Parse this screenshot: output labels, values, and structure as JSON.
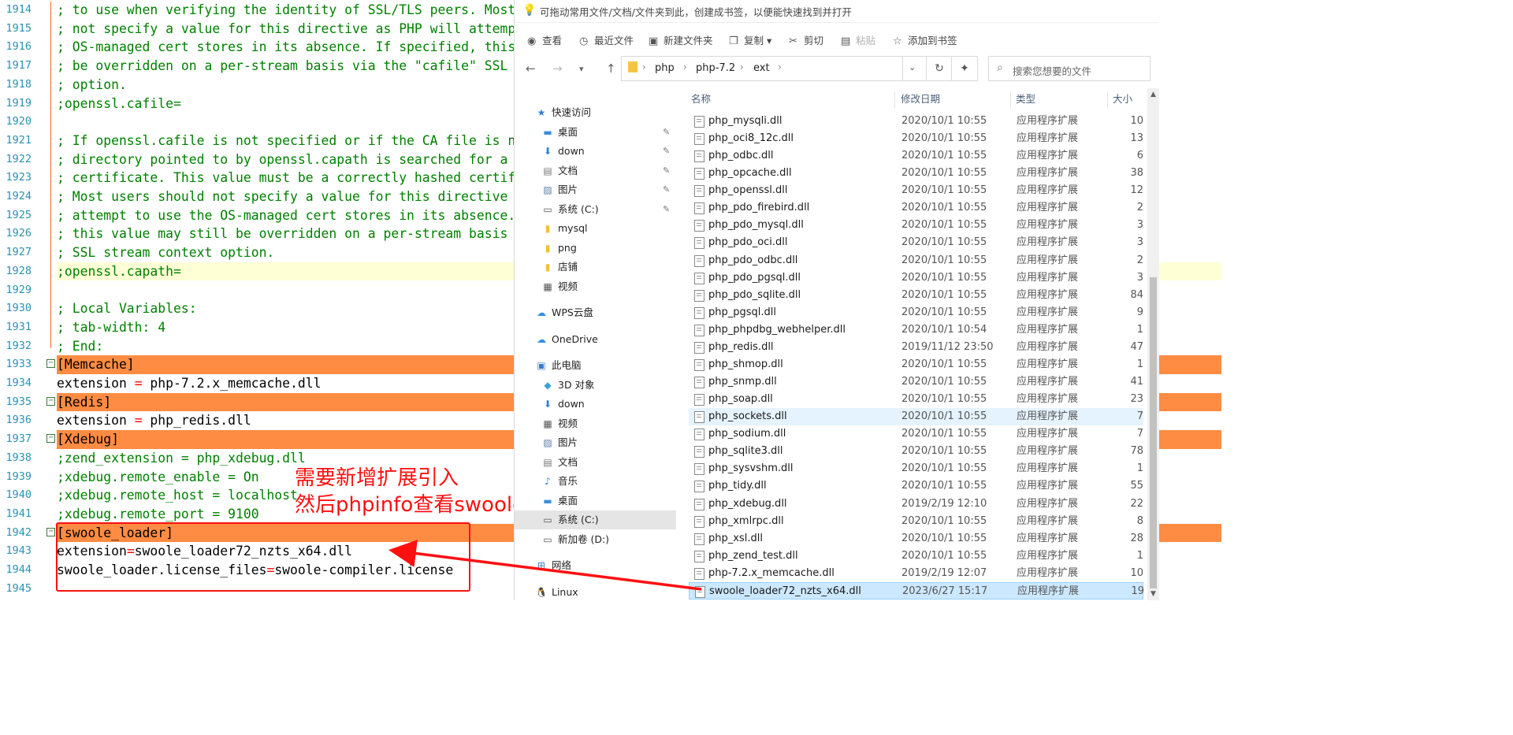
{
  "editor": {
    "lines": [
      {
        "n": "1914",
        "t": "; to use when verifying the identity of SSL/TLS peers. Most users should",
        "k": "comment"
      },
      {
        "n": "1915",
        "t": "; not specify a value for this directive as PHP will attempt to use the",
        "k": "comment"
      },
      {
        "n": "1916",
        "t": "; OS-managed cert stores in its absence. If specified, this value may still",
        "k": "comment"
      },
      {
        "n": "1917",
        "t": "; be overridden on a per-stream basis via the \"cafile\" SSL stream context",
        "k": "comment"
      },
      {
        "n": "1918",
        "t": "; option.",
        "k": "comment"
      },
      {
        "n": "1919",
        "t": ";openssl.cafile=",
        "k": "comment"
      },
      {
        "n": "1920",
        "t": "",
        "k": "comment"
      },
      {
        "n": "1921",
        "t": "; If openssl.cafile is not specified or if the CA file is not found, the",
        "k": "comment"
      },
      {
        "n": "1922",
        "t": "; directory pointed to by openssl.capath is searched for a suitable",
        "k": "comment"
      },
      {
        "n": "1923",
        "t": "; certificate. This value must be a correctly hashed certificate directory.",
        "k": "comment"
      },
      {
        "n": "1924",
        "t": "; Most users should not specify a value for this directive as PHP will",
        "k": "comment"
      },
      {
        "n": "1925",
        "t": "; attempt to use the OS-managed cert stores in its absence. If specified,",
        "k": "comment"
      },
      {
        "n": "1926",
        "t": "; this value may still be overridden on a per-stream basis via the \"capath\"",
        "k": "comment"
      },
      {
        "n": "1927",
        "t": "; SSL stream context option.",
        "k": "comment"
      },
      {
        "n": "1928",
        "t": ";openssl.capath=",
        "k": "comment",
        "hl": true
      },
      {
        "n": "1929",
        "t": "",
        "k": "comment"
      },
      {
        "n": "1930",
        "t": "; Local Variables:",
        "k": "comment"
      },
      {
        "n": "1931",
        "t": "; tab-width: 4",
        "k": "comment"
      },
      {
        "n": "1932",
        "t": "; End:",
        "k": "comment"
      },
      {
        "n": "1933",
        "t": "[Memcache]",
        "k": "section"
      },
      {
        "n": "1934",
        "a": "extension ",
        "o": "=",
        "b": " php-7.2.x_memcache.dll",
        "k": "kv"
      },
      {
        "n": "1935",
        "t": "[Redis]",
        "k": "section"
      },
      {
        "n": "1936",
        "a": "extension ",
        "o": "=",
        "b": " php_redis.dll",
        "k": "kv"
      },
      {
        "n": "1937",
        "t": "[Xdebug]",
        "k": "section"
      },
      {
        "n": "1938",
        "t": ";zend_extension = php_xdebug.dll",
        "k": "comment"
      },
      {
        "n": "1939",
        "t": ";xdebug.remote_enable = On",
        "k": "comment"
      },
      {
        "n": "1940",
        "t": ";xdebug.remote_host = localhost",
        "k": "comment"
      },
      {
        "n": "1941",
        "t": ";xdebug.remote_port = 9100",
        "k": "comment"
      },
      {
        "n": "1942",
        "t": "[swoole_loader]",
        "k": "section"
      },
      {
        "n": "1943",
        "a": "extension",
        "o": "=",
        "b": "swoole_loader72_nzts_x64.dll",
        "k": "kv"
      },
      {
        "n": "1944",
        "a": "swoole_loader.license_files",
        "o": "=",
        "b": "swoole-compiler.license",
        "k": "kv"
      },
      {
        "n": "1945",
        "t": "",
        "k": "comment"
      }
    ]
  },
  "annotation": {
    "line1": "需要新增扩展引入",
    "line2": "然后phpinfo查看swoole_loader是否开启",
    "color": "#ff1010"
  },
  "explorer": {
    "bookmark_hint": "可拖动常用文件/文档/文件夹到此，创建成书签，以便能快速找到并打开",
    "toolbar": [
      "查看",
      "最近文件",
      "新建文件夹",
      "复制",
      "剪切",
      "粘贴",
      "添加到书签"
    ],
    "breadcrumb": [
      "php",
      "php-7.2",
      "ext"
    ],
    "search_placeholder": "搜索您想要的文件",
    "sidebar": [
      {
        "label": "快速访问",
        "icon": "star-icon",
        "level": 0,
        "pin": false
      },
      {
        "label": "桌面",
        "icon": "desktop-icon",
        "level": 1,
        "pin": true
      },
      {
        "label": "down",
        "icon": "download-icon",
        "level": 1,
        "pin": true
      },
      {
        "label": "文档",
        "icon": "document-icon",
        "level": 1,
        "pin": true
      },
      {
        "label": "图片",
        "icon": "picture-icon",
        "level": 1,
        "pin": true
      },
      {
        "label": "系统 (C:)",
        "icon": "drive-icon",
        "level": 1,
        "pin": true
      },
      {
        "label": "mysql",
        "icon": "folder-icon",
        "level": 1,
        "pin": false
      },
      {
        "label": "png",
        "icon": "folder-icon",
        "level": 1,
        "pin": false
      },
      {
        "label": "店铺",
        "icon": "folder-icon",
        "level": 1,
        "pin": false
      },
      {
        "label": "视频",
        "icon": "video-icon",
        "level": 1,
        "pin": false
      },
      {
        "label": "WPS云盘",
        "icon": "cloud-icon",
        "level": 0,
        "pin": false,
        "gap": true
      },
      {
        "label": "OneDrive",
        "icon": "cloud-icon",
        "level": 0,
        "pin": false,
        "gap": true
      },
      {
        "label": "此电脑",
        "icon": "computer-icon",
        "level": 0,
        "pin": false,
        "gap": true
      },
      {
        "label": "3D 对象",
        "icon": "cube-icon",
        "level": 1,
        "pin": false
      },
      {
        "label": "down",
        "icon": "download-icon",
        "level": 1,
        "pin": false
      },
      {
        "label": "视频",
        "icon": "video-icon",
        "level": 1,
        "pin": false
      },
      {
        "label": "图片",
        "icon": "picture-icon",
        "level": 1,
        "pin": false
      },
      {
        "label": "文档",
        "icon": "document-icon",
        "level": 1,
        "pin": false
      },
      {
        "label": "音乐",
        "icon": "music-icon",
        "level": 1,
        "pin": false
      },
      {
        "label": "桌面",
        "icon": "desktop-icon",
        "level": 1,
        "pin": false
      },
      {
        "label": "系统 (C:)",
        "icon": "drive-icon",
        "level": 1,
        "pin": false,
        "sel": true
      },
      {
        "label": "新加卷 (D:)",
        "icon": "drive-icon",
        "level": 1,
        "pin": false
      },
      {
        "label": "网络",
        "icon": "network-icon",
        "level": 0,
        "pin": false,
        "gap": true
      },
      {
        "label": "Linux",
        "icon": "linux-icon",
        "level": 0,
        "pin": false,
        "gap": true
      }
    ],
    "columns": {
      "name": "名称",
      "date": "修改日期",
      "type": "类型",
      "size": "大小"
    },
    "files": [
      {
        "name": "php_mysqli.dll",
        "date": "2020/10/1 10:55",
        "type": "应用程序扩展",
        "size": "10"
      },
      {
        "name": "php_oci8_12c.dll",
        "date": "2020/10/1 10:55",
        "type": "应用程序扩展",
        "size": "13"
      },
      {
        "name": "php_odbc.dll",
        "date": "2020/10/1 10:55",
        "type": "应用程序扩展",
        "size": "6"
      },
      {
        "name": "php_opcache.dll",
        "date": "2020/10/1 10:55",
        "type": "应用程序扩展",
        "size": "38"
      },
      {
        "name": "php_openssl.dll",
        "date": "2020/10/1 10:55",
        "type": "应用程序扩展",
        "size": "12"
      },
      {
        "name": "php_pdo_firebird.dll",
        "date": "2020/10/1 10:55",
        "type": "应用程序扩展",
        "size": "2"
      },
      {
        "name": "php_pdo_mysql.dll",
        "date": "2020/10/1 10:55",
        "type": "应用程序扩展",
        "size": "3"
      },
      {
        "name": "php_pdo_oci.dll",
        "date": "2020/10/1 10:55",
        "type": "应用程序扩展",
        "size": "3"
      },
      {
        "name": "php_pdo_odbc.dll",
        "date": "2020/10/1 10:55",
        "type": "应用程序扩展",
        "size": "2"
      },
      {
        "name": "php_pdo_pgsql.dll",
        "date": "2020/10/1 10:55",
        "type": "应用程序扩展",
        "size": "3"
      },
      {
        "name": "php_pdo_sqlite.dll",
        "date": "2020/10/1 10:55",
        "type": "应用程序扩展",
        "size": "84"
      },
      {
        "name": "php_pgsql.dll",
        "date": "2020/10/1 10:55",
        "type": "应用程序扩展",
        "size": "9"
      },
      {
        "name": "php_phpdbg_webhelper.dll",
        "date": "2020/10/1 10:54",
        "type": "应用程序扩展",
        "size": "1"
      },
      {
        "name": "php_redis.dll",
        "date": "2019/11/12 23:50",
        "type": "应用程序扩展",
        "size": "47"
      },
      {
        "name": "php_shmop.dll",
        "date": "2020/10/1 10:55",
        "type": "应用程序扩展",
        "size": "1"
      },
      {
        "name": "php_snmp.dll",
        "date": "2020/10/1 10:55",
        "type": "应用程序扩展",
        "size": "41"
      },
      {
        "name": "php_soap.dll",
        "date": "2020/10/1 10:55",
        "type": "应用程序扩展",
        "size": "23"
      },
      {
        "name": "php_sockets.dll",
        "date": "2020/10/1 10:55",
        "type": "应用程序扩展",
        "size": "7",
        "hover": true
      },
      {
        "name": "php_sodium.dll",
        "date": "2020/10/1 10:55",
        "type": "应用程序扩展",
        "size": "7"
      },
      {
        "name": "php_sqlite3.dll",
        "date": "2020/10/1 10:55",
        "type": "应用程序扩展",
        "size": "78"
      },
      {
        "name": "php_sysvshm.dll",
        "date": "2020/10/1 10:55",
        "type": "应用程序扩展",
        "size": "1"
      },
      {
        "name": "php_tidy.dll",
        "date": "2020/10/1 10:55",
        "type": "应用程序扩展",
        "size": "55"
      },
      {
        "name": "php_xdebug.dll",
        "date": "2019/2/19 12:10",
        "type": "应用程序扩展",
        "size": "22"
      },
      {
        "name": "php_xmlrpc.dll",
        "date": "2020/10/1 10:55",
        "type": "应用程序扩展",
        "size": "8"
      },
      {
        "name": "php_xsl.dll",
        "date": "2020/10/1 10:55",
        "type": "应用程序扩展",
        "size": "28"
      },
      {
        "name": "php_zend_test.dll",
        "date": "2020/10/1 10:55",
        "type": "应用程序扩展",
        "size": "1"
      },
      {
        "name": "php-7.2.x_memcache.dll",
        "date": "2019/2/19 12:07",
        "type": "应用程序扩展",
        "size": "10"
      },
      {
        "name": "swoole_loader72_nzts_x64.dll",
        "date": "2023/6/27 15:17",
        "type": "应用程序扩展",
        "size": "19",
        "sel": true
      }
    ]
  }
}
